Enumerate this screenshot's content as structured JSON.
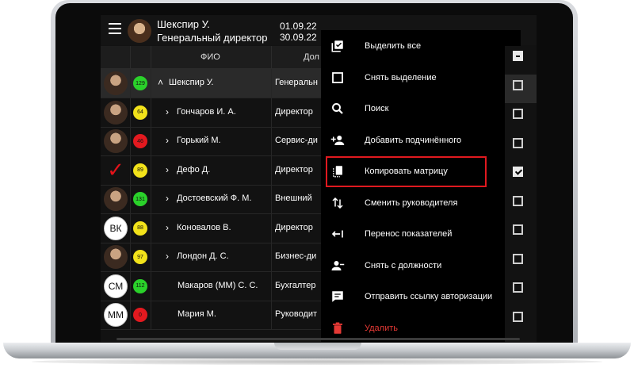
{
  "header": {
    "user_name": "Шекспир У.",
    "user_role": "Генеральный директор",
    "date_from": "01.09.22",
    "date_to": "30.09.22"
  },
  "table": {
    "col_fio": "ФИО",
    "col_position": "Дол",
    "rows": [
      {
        "avatar": "photo",
        "initials": "",
        "score": "129",
        "score_color": "#2ad12a",
        "chevron": "˄",
        "name": "Шекспир У.",
        "position": "Генеральн",
        "selected": true
      },
      {
        "avatar": "photo",
        "initials": "",
        "score": "64",
        "score_color": "#f2e21a",
        "chevron": "›",
        "name": "Гончаров И. А.",
        "position": "Директор"
      },
      {
        "avatar": "photo",
        "initials": "",
        "score": "46",
        "score_color": "#e3191f",
        "chevron": "›",
        "name": "Горький М.",
        "position": "Сервис-ди"
      },
      {
        "avatar": "check",
        "initials": "✓",
        "score": "89",
        "score_color": "#f2e21a",
        "chevron": "›",
        "name": "Дефо Д.",
        "position": "Директор"
      },
      {
        "avatar": "photo",
        "initials": "",
        "score": "131",
        "score_color": "#2ad12a",
        "chevron": "›",
        "name": "Достоевский Ф. М.",
        "position": "Внешний"
      },
      {
        "avatar": "white",
        "initials": "ВК",
        "score": "88",
        "score_color": "#f2e21a",
        "chevron": "›",
        "name": "Коновалов В.",
        "position": "Директор"
      },
      {
        "avatar": "photo",
        "initials": "",
        "score": "97",
        "score_color": "#f2e21a",
        "chevron": "›",
        "name": "Лондон Д. С.",
        "position": "Бизнес-ди"
      },
      {
        "avatar": "white",
        "initials": "СМ",
        "score": "112",
        "score_color": "#2ad12a",
        "chevron": "",
        "name": "Макаров (ММ) С. С.",
        "position": "Бухгалтер"
      },
      {
        "avatar": "white",
        "initials": "ММ",
        "score": "0",
        "score_color": "#e3191f",
        "chevron": "",
        "name": "Мария М.",
        "position": "Руководит"
      }
    ]
  },
  "menu": {
    "items": [
      {
        "icon": "select-all-icon",
        "label": "Выделить все"
      },
      {
        "icon": "checkbox-blank-icon",
        "label": "Снять выделение"
      },
      {
        "icon": "search-icon",
        "label": "Поиск"
      },
      {
        "icon": "person-add-icon",
        "label": "Добавить подчинённого"
      },
      {
        "icon": "copy-icon",
        "label": "Копировать матрицу",
        "highlighted": true
      },
      {
        "icon": "swap-vert-icon",
        "label": "Сменить руководителя"
      },
      {
        "icon": "transfer-icon",
        "label": "Перенос показателей"
      },
      {
        "icon": "person-remove-icon",
        "label": "Снять с должности"
      },
      {
        "icon": "message-icon",
        "label": "Отправить ссылку авторизации"
      },
      {
        "icon": "delete-icon",
        "label": "Удалить",
        "danger": true
      }
    ],
    "highlight_color": "#e0191f",
    "danger_color": "#e53935"
  },
  "checkboxes": [
    "indeterminate",
    "unchecked",
    "unchecked",
    "unchecked",
    "checked",
    "unchecked",
    "unchecked",
    "unchecked",
    "unchecked",
    "unchecked"
  ]
}
